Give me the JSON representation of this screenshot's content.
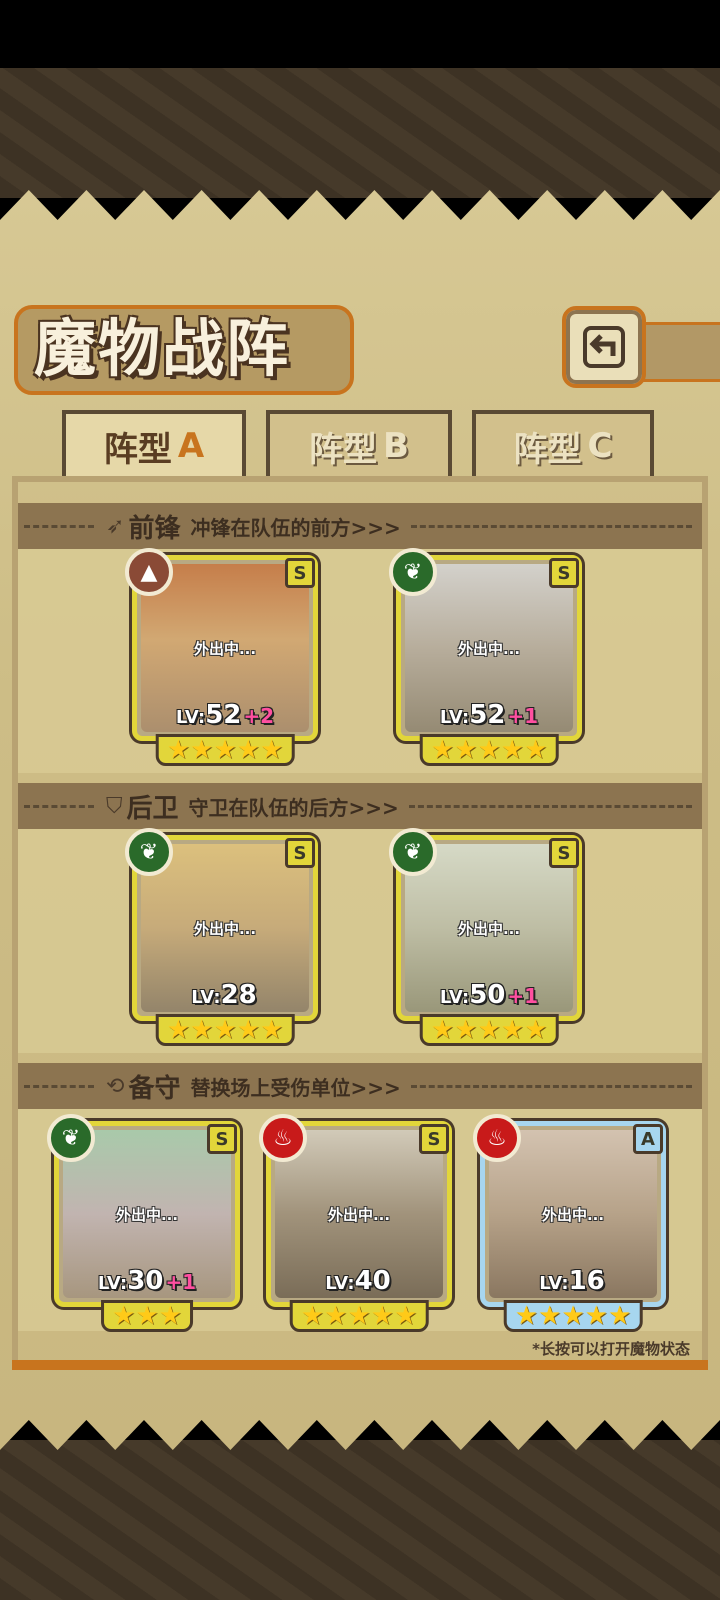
{
  "title": "魔物战阵",
  "back_icon": "back-arrow-icon",
  "tabs": [
    {
      "label": "阵型",
      "suffix": "A",
      "active": true
    },
    {
      "label": "阵型",
      "suffix": "B",
      "active": false
    },
    {
      "label": "阵型",
      "suffix": "C",
      "active": false
    }
  ],
  "sections": {
    "front": {
      "title": "前锋",
      "desc": "冲锋在队伍的前方>>>",
      "icon": "sword-icon"
    },
    "rear": {
      "title": "后卫",
      "desc": "守卫在队伍的后方>>>",
      "icon": "shield-icon"
    },
    "reserve": {
      "title": "备守",
      "desc": "替换场上受伤单位>>>",
      "icon": "swap-icon"
    }
  },
  "units": {
    "front": [
      {
        "status": "外出中...",
        "lv_prefix": "LV:",
        "level": "52",
        "bonus": "+2",
        "rank": "S",
        "element": "earth",
        "stars": 5
      },
      {
        "status": "外出中...",
        "lv_prefix": "LV:",
        "level": "52",
        "bonus": "+1",
        "rank": "S",
        "element": "nature",
        "stars": 5
      }
    ],
    "rear": [
      {
        "status": "外出中...",
        "lv_prefix": "LV:",
        "level": "28",
        "bonus": "",
        "rank": "S",
        "element": "nature",
        "stars": 5
      },
      {
        "status": "外出中...",
        "lv_prefix": "LV:",
        "level": "50",
        "bonus": "+1",
        "rank": "S",
        "element": "nature",
        "stars": 5
      }
    ],
    "reserve": [
      {
        "status": "外出中...",
        "lv_prefix": "LV:",
        "level": "30",
        "bonus": "+1",
        "rank": "S",
        "element": "nature",
        "stars": 3
      },
      {
        "status": "外出中...",
        "lv_prefix": "LV:",
        "level": "40",
        "bonus": "",
        "rank": "S",
        "element": "fire",
        "stars": 5
      },
      {
        "status": "外出中...",
        "lv_prefix": "LV:",
        "level": "16",
        "bonus": "",
        "rank": "A",
        "element": "fire",
        "stars": 5
      }
    ]
  },
  "star_glyphs": {
    "three": "★★★",
    "five": "★★★★★"
  },
  "footer_note": "*长按可以打开魔物状态",
  "colors": {
    "rank_s": "#e2d63a",
    "rank_a": "#a7d6ef",
    "accent": "#c8741e",
    "bonus": "#ff4fa0"
  }
}
